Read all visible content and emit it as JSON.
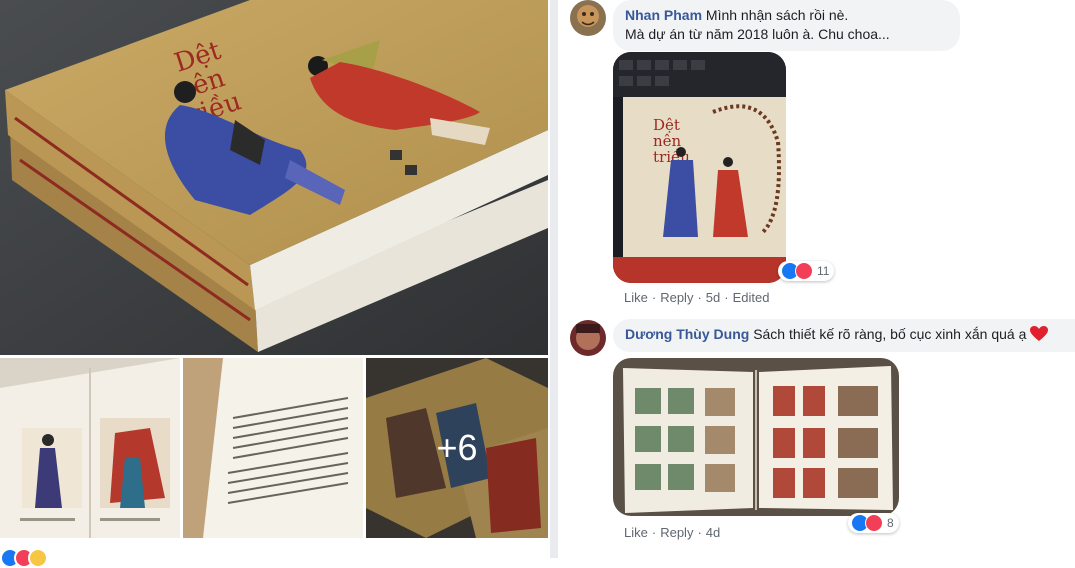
{
  "photos": {
    "main_alt": "book cover photo",
    "more_count": "+6"
  },
  "comments": [
    {
      "author": "Nhan Pham",
      "text_line1": "Mình nhận sách rồi nè.",
      "text_line2": "Mà dự án từ năm 2018 luôn à. Chu choa...",
      "actions": {
        "like": "Like",
        "reply": "Reply",
        "time": "5d",
        "edited": "Edited"
      },
      "reactions": {
        "count": "11",
        "types": [
          "like",
          "love"
        ]
      }
    },
    {
      "author": "Dương Thùy Dung",
      "text": "Sách thiết kế rõ ràng, bố cục xinh xắn quá ạ",
      "actions": {
        "like": "Like",
        "reply": "Reply",
        "time": "4d"
      },
      "reactions": {
        "count": "8",
        "types": [
          "like",
          "love"
        ]
      }
    }
  ],
  "colors": {
    "author": "#385898",
    "bubble": "#f2f3f5",
    "like": "#1877f2",
    "love": "#f33e58",
    "meta": "#606770",
    "divider": "#e9ebee"
  }
}
